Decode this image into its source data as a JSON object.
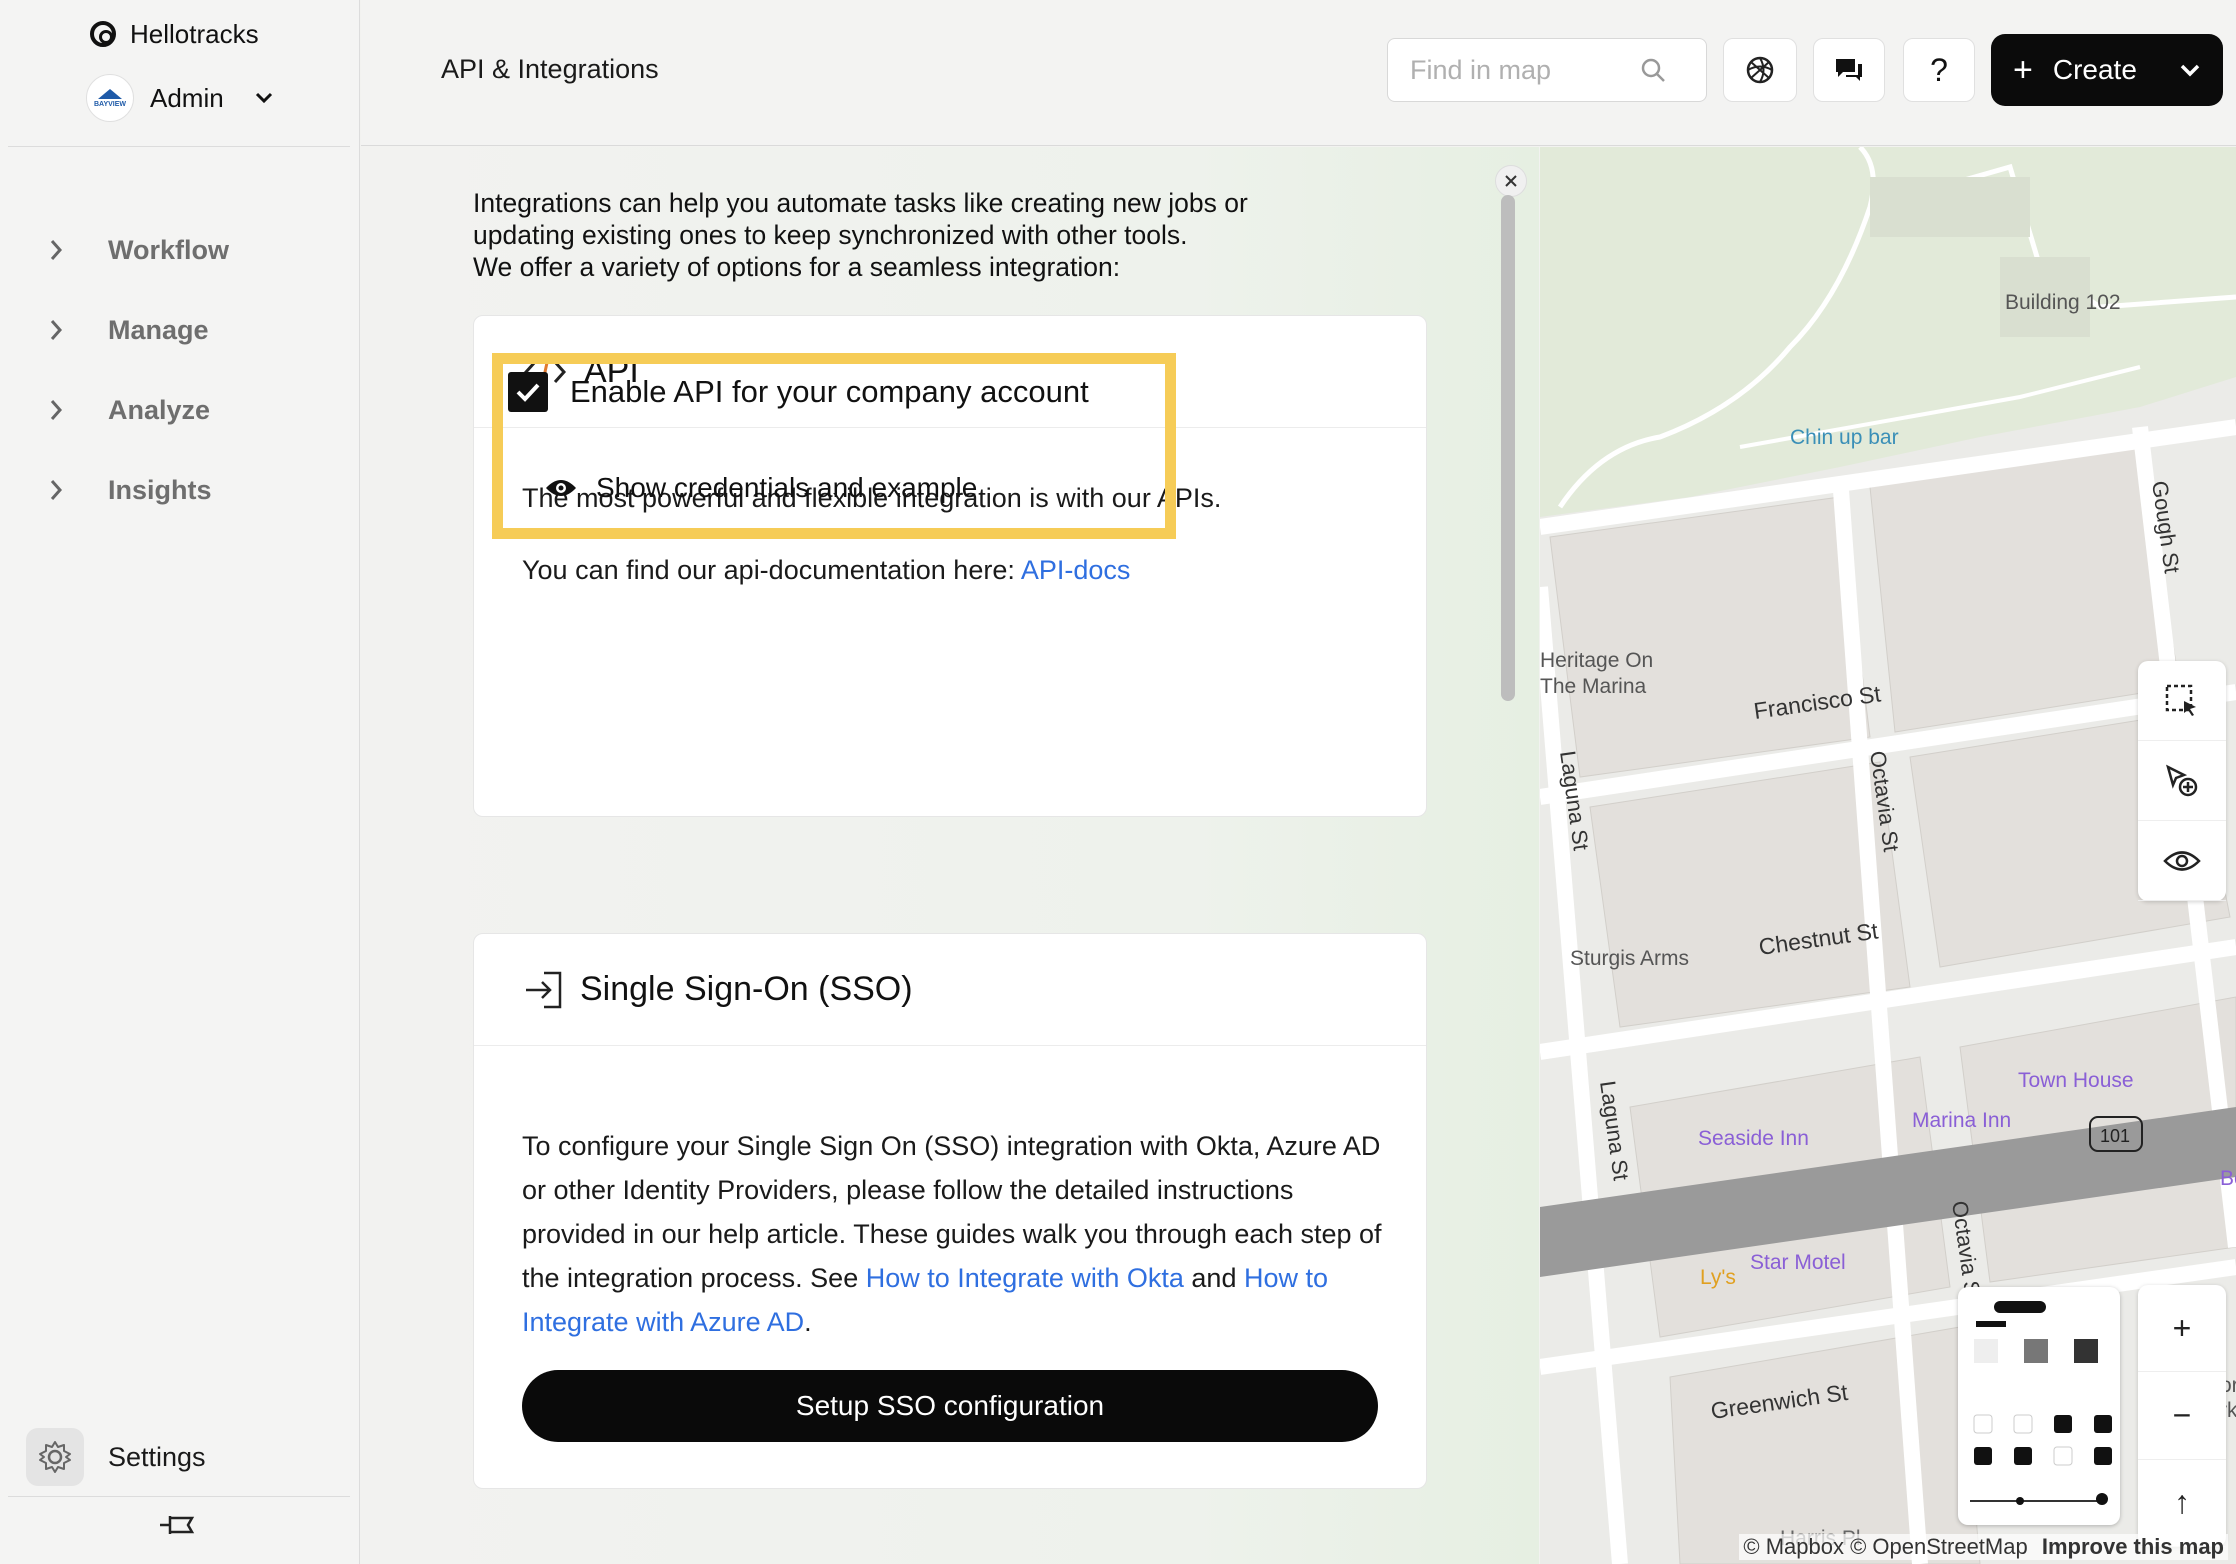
{
  "sidebar": {
    "brand": "Hellotracks",
    "account": {
      "name": "Admin",
      "avatar_text": "BAYVIEW"
    },
    "nav": [
      {
        "label": "Workflow"
      },
      {
        "label": "Manage"
      },
      {
        "label": "Analyze"
      },
      {
        "label": "Insights"
      }
    ],
    "settings_label": "Settings"
  },
  "header": {
    "title": "API & Integrations",
    "search_placeholder": "Find in map",
    "create_label": "Create",
    "help_label": "?"
  },
  "content": {
    "intro_lines": [
      "Integrations can help you automate tasks like creating new jobs or",
      "updating existing ones to keep synchronized with other tools.",
      "We offer a variety of options for a seamless integration:"
    ],
    "api": {
      "title": "API",
      "text1": "The most powerful and flexible integration is with our APIs.",
      "text2": "You can find our api-documentation here:",
      "link": "API-docs",
      "enable_label": "Enable API for your company account",
      "enable_checked": true,
      "credentials_label": "Show credentials and example"
    },
    "sso": {
      "title": "Single Sign-On (SSO)",
      "text_before": "To configure your Single Sign On (SSO) integration with Okta, Azure AD or other Identity Providers, please follow the detailed instructions provided in our help article. These guides walk you through each step of the integration process. See",
      "link_okta": "How to Integrate with Okta",
      "and": "and",
      "link_azure": "How to Integrate with Azure AD",
      "period": ".",
      "button": "Setup SSO configuration"
    }
  },
  "map": {
    "labels": {
      "building": "Building 102",
      "chinup": "Chin up bar",
      "heritage1": "Heritage On",
      "heritage2": "The Marina",
      "francisco": "Francisco St",
      "gough": "Gough St",
      "laguna1": "Laguna St",
      "octavia1": "Octavia St",
      "sturgis": "Sturgis Arms",
      "chestnut": "Chestnut St",
      "townhouse": "Town House",
      "marinainn": "Marina Inn",
      "seaside": "Seaside Inn",
      "hwy": "101",
      "laguna2": "Laguna St",
      "octavia2": "Octavia St",
      "lys": "Ly's",
      "starmotel": "Star Motel",
      "greenwich": "Greenwich St",
      "harris": "Harris Pl",
      "bo": "Bo",
      "ork": "or",
      "ork2": "rk"
    },
    "zoom_in": "+",
    "zoom_out": "−",
    "north": "↑",
    "attribution": "© Mapbox © OpenStreetMap",
    "improve": "Improve this map"
  }
}
